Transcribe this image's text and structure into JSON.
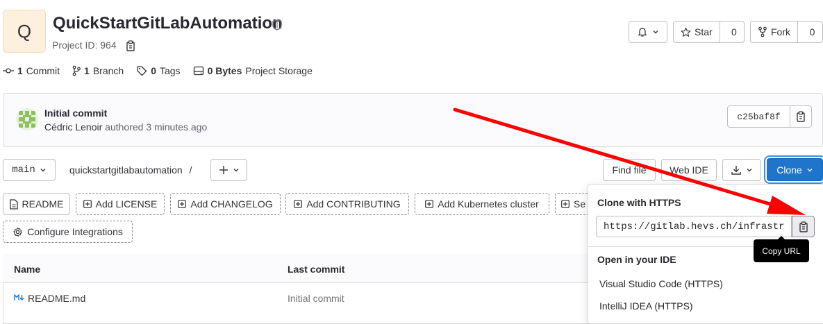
{
  "project": {
    "avatar_letter": "Q",
    "name": "QuickStartGitLabAutomation",
    "id_label": "Project ID: 964"
  },
  "actions": {
    "star_label": "Star",
    "star_count": "0",
    "fork_label": "Fork",
    "fork_count": "0"
  },
  "stats": {
    "commits_count": "1",
    "commits_label": "Commit",
    "branches_count": "1",
    "branches_label": "Branch",
    "tags_count": "0",
    "tags_label": "Tags",
    "storage_size": "0 Bytes",
    "storage_label": "Project Storage"
  },
  "last_commit": {
    "title": "Initial commit",
    "author": "Cédric Lenoir",
    "meta": "authored 3 minutes ago",
    "sha": "c25baf8f"
  },
  "repo_nav": {
    "branch": "main",
    "path": "quickstartgitlabautomation",
    "path_sep": "/",
    "find_file": "Find file",
    "web_ide": "Web IDE",
    "clone": "Clone"
  },
  "quick_actions": [
    "README",
    "Add LICENSE",
    "Add CHANGELOG",
    "Add CONTRIBUTING",
    "Add Kubernetes cluster",
    "Se",
    "Configure Integrations"
  ],
  "table": {
    "col_name": "Name",
    "col_last_commit": "Last commit",
    "rows": [
      {
        "name": "README.md",
        "last_commit": "Initial commit"
      }
    ]
  },
  "clone_dropdown": {
    "https_heading": "Clone with HTTPS",
    "https_url": "https://gitlab.hevs.ch/infrastr",
    "copy_tooltip": "Copy URL",
    "ide_heading": "Open in your IDE",
    "ide_items": [
      "Visual Studio Code (HTTPS)",
      "IntelliJ IDEA (HTTPS)"
    ]
  },
  "colors": {
    "primary": "#1f75cb",
    "annotation_arrow": "#ff0000"
  }
}
